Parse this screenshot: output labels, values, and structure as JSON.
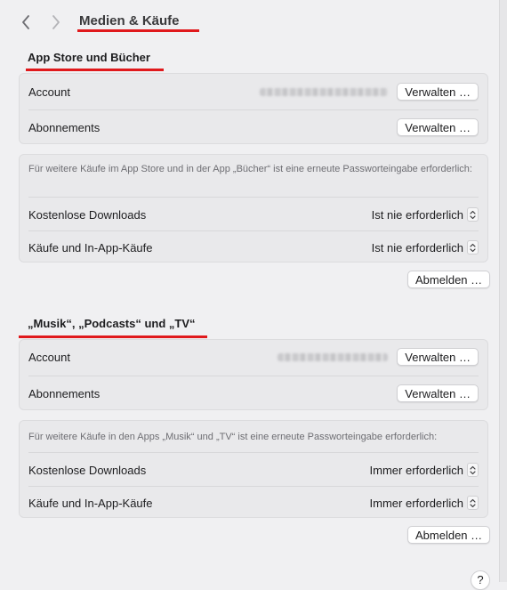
{
  "header": {
    "title": "Medien & Käufe",
    "back_icon": "chevron-left-icon",
    "forward_icon": "chevron-right-icon"
  },
  "annotation_color": "#e0191c",
  "app_store": {
    "section_title": "App Store und Bücher",
    "account_label": "Account",
    "account_button": "Verwalten …",
    "subscriptions_label": "Abonnements",
    "subscriptions_button": "Verwalten …",
    "note": "Für weitere Käufe im App Store und in der App „Bücher“ ist eine erneute Passworteingabe erforderlich:",
    "free_downloads_label": "Kostenlose Downloads",
    "free_downloads_value": "Ist nie erforderlich",
    "purchases_label": "Käufe und In-App-Käufe",
    "purchases_value": "Ist nie erforderlich",
    "sign_out_button": "Abmelden …"
  },
  "media": {
    "section_title": "„Musik“, „Podcasts“ und „TV“",
    "account_label": "Account",
    "account_button": "Verwalten …",
    "subscriptions_label": "Abonnements",
    "subscriptions_button": "Verwalten …",
    "note": "Für weitere Käufe in den Apps „Musik“ und „TV“ ist eine erneute Passworteingabe erforderlich:",
    "free_downloads_label": "Kostenlose Downloads",
    "free_downloads_value": "Immer erforderlich",
    "purchases_label": "Käufe und In-App-Käufe",
    "purchases_value": "Immer erforderlich",
    "sign_out_button": "Abmelden …"
  },
  "help_button": "?"
}
